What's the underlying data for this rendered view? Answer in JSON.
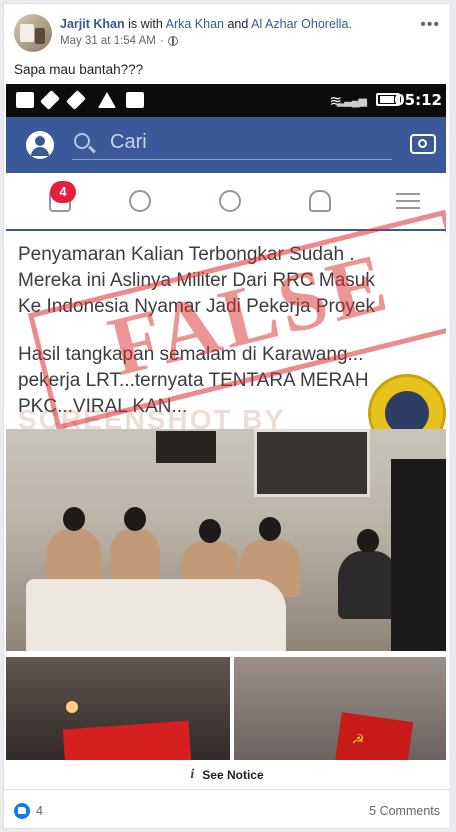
{
  "post": {
    "author": "Jarjit Khan",
    "with_text": "is with",
    "tagged_1": "Arka Khan",
    "and_text": "and",
    "tagged_2": "Al Azhar Ohorella.",
    "timestamp": "May 31 at 1:54 AM",
    "privacy_icon": "globe-icon",
    "more_icon": "ellipsis-icon",
    "caption": "Sapa mau bantah???",
    "see_notice": "See Notice",
    "likes_count": "4",
    "comments_label": "5 Comments"
  },
  "shared_image": {
    "status_time": "05:12",
    "search_placeholder": "Cari",
    "notification_badge": "4",
    "text_line_1": "Penyamaran Kalian Terbongkar Sudah .",
    "text_line_2": "Mereka ini Aslinya Militer Dari RRC Masuk",
    "text_line_3": "Ke Indonesia Nyamar Jadi Pekerja Proyek",
    "text_line_4": "Hasil tangkapan semalam di Karawang...",
    "text_line_5": "pekerja LRT...ternyata TENTARA MERAH",
    "text_line_6": "PKC...VIRAL KAN...",
    "watermark_text": "SCREENSHOT BY",
    "stamp_text": "FALSE",
    "stamp_color": "#da2c2c",
    "logo_name": "turnbackhoax-logo"
  }
}
